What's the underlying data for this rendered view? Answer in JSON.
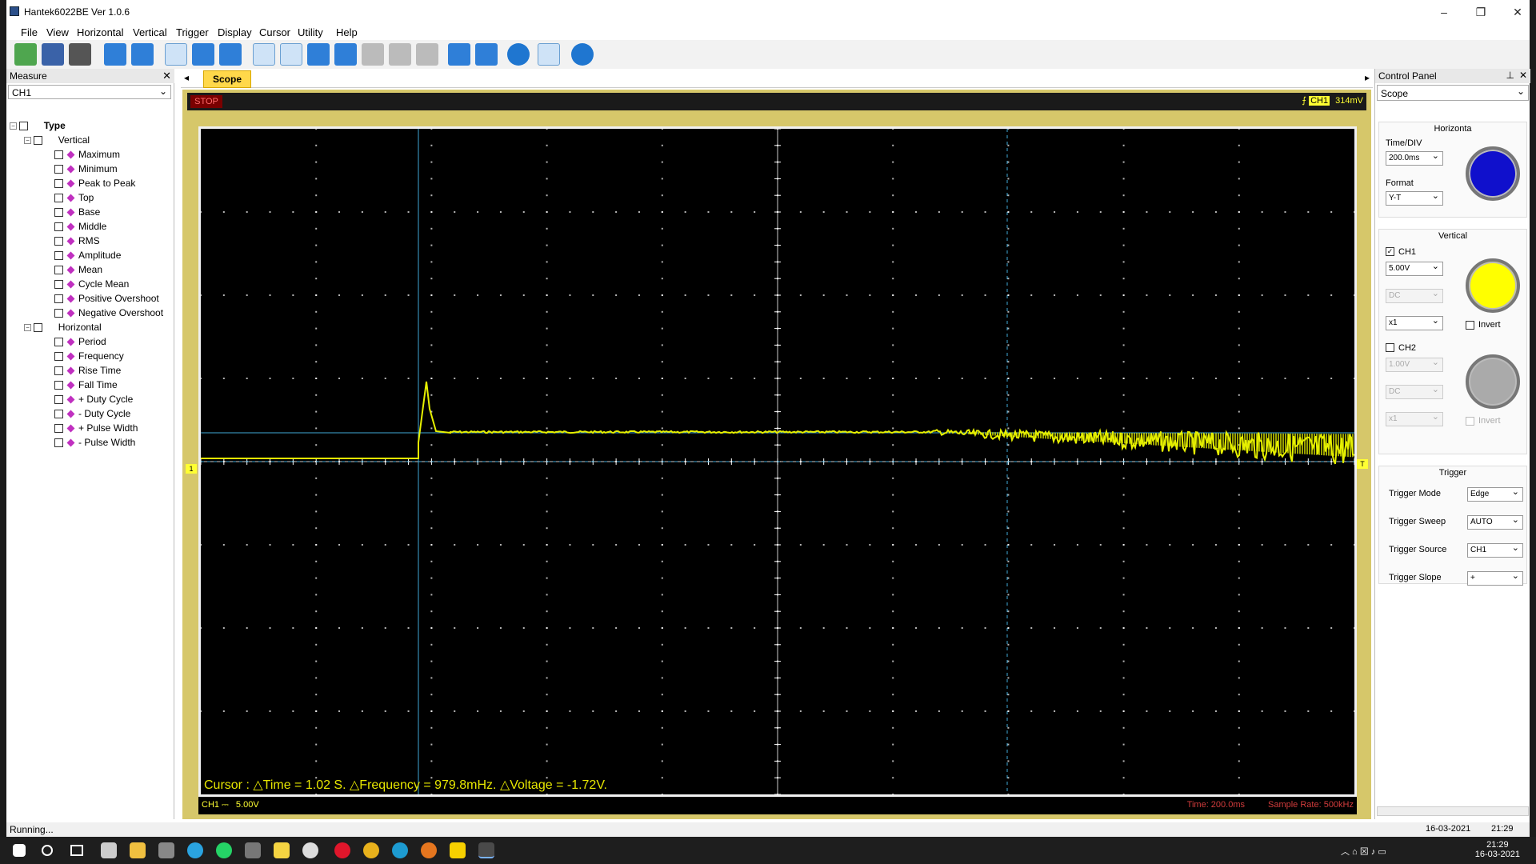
{
  "window": {
    "title": "Hantek6022BE Ver 1.0.6",
    "minimize": "–",
    "maximize": "❐",
    "close": "✕"
  },
  "menu": [
    "File",
    "View",
    "Horizontal",
    "Vertical",
    "Trigger",
    "Display",
    "Cursor",
    "Utility",
    "Help"
  ],
  "measure": {
    "title": "Measure",
    "channel": "CH1",
    "root": "Type",
    "vertical_label": "Vertical",
    "vertical_items": [
      "Maximum",
      "Minimum",
      "Peak to Peak",
      "Top",
      "Base",
      "Middle",
      "RMS",
      "Amplitude",
      "Mean",
      "Cycle Mean",
      "Positive Overshoot",
      "Negative Overshoot"
    ],
    "horizontal_label": "Horizontal",
    "horizontal_items": [
      "Period",
      "Frequency",
      "Rise Time",
      "Fall Time",
      "+ Duty Cycle",
      "- Duty Cycle",
      "+ Pulse Width",
      "- Pulse Width"
    ]
  },
  "scope": {
    "tab": "Scope",
    "state": "STOP",
    "trigger_channel": "CH1",
    "trigger_level": "314mV",
    "cursor_readout": "Cursor : △Time = 1.02 S. △Frequency = 979.8mHz. △Voltage = -1.72V.",
    "ch1_scale_label": "CH1 ⎓",
    "ch1_scale_value": "5.00V",
    "time_scale": "Time: 200.0ms",
    "sample_rate": "Sample Rate: 500kHz"
  },
  "control_panel": {
    "title": "Control Panel",
    "mode": "Scope",
    "horizontal": {
      "title": "Horizonta",
      "time_div_label": "Time/DIV",
      "time_div": "200.0ms",
      "format_label": "Format",
      "format": "Y-T"
    },
    "vertical": {
      "title": "Vertical",
      "ch1": {
        "label": "CH1",
        "enabled": true,
        "volts": "5.00V",
        "coupling": "DC",
        "probe": "x1",
        "invert_label": "Invert"
      },
      "ch2": {
        "label": "CH2",
        "enabled": false,
        "volts": "1.00V",
        "coupling": "DC",
        "probe": "x1",
        "invert_label": "Invert"
      }
    },
    "trigger": {
      "title": "Trigger",
      "mode_label": "Trigger Mode",
      "mode": "Edge",
      "sweep_label": "Trigger Sweep",
      "sweep": "AUTO",
      "source_label": "Trigger Source",
      "source": "CH1",
      "slope_label": "Trigger Slope",
      "slope": "+"
    }
  },
  "status": {
    "text": "Running...",
    "date": "16-03-2021",
    "time": "21:29"
  },
  "taskbar": {
    "clock_time": "21:29",
    "clock_date": "16-03-2021"
  },
  "colors": {
    "trace": "#e6f000",
    "grid": "#ffffff",
    "cursor": "#3fa9d6",
    "knob_horizontal": "#1010cc",
    "knob_ch1": "#ffff00",
    "knob_ch2": "#aaaaaa"
  }
}
